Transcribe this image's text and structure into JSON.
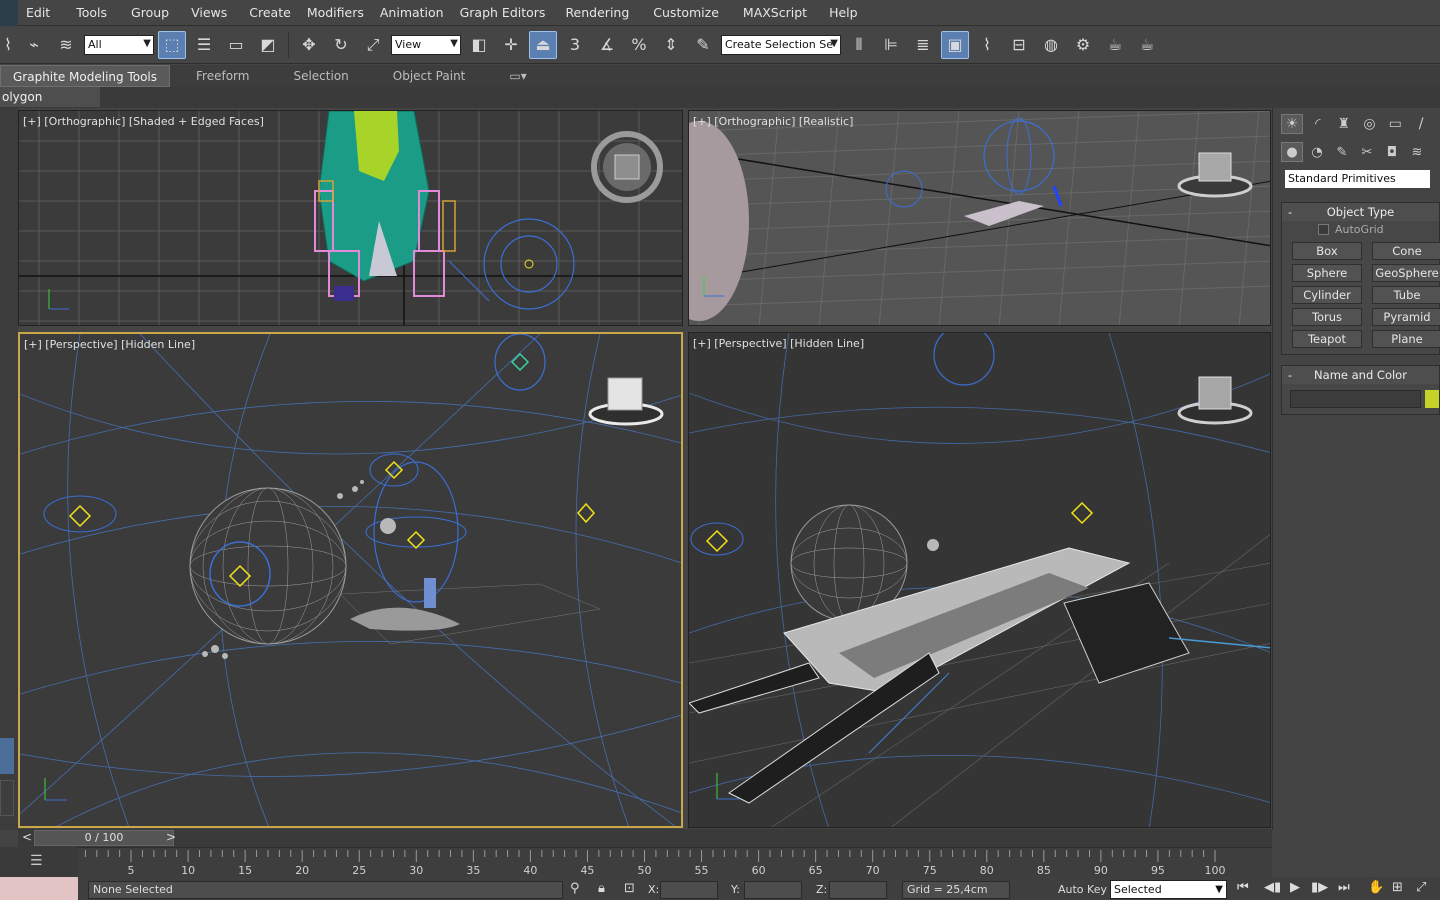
{
  "menubar": {
    "items": [
      "Edit",
      "Tools",
      "Group",
      "Views",
      "Create",
      "Modifiers",
      "Animation",
      "Graph Editors",
      "Rendering",
      "Customize",
      "MAXScript",
      "Help"
    ]
  },
  "toolbar": {
    "filter_value": "All",
    "refcoord_value": "View",
    "named_selection_value": "Create Selection Se",
    "snap_label": "3",
    "angle_label": "%",
    "icons": [
      "link-icon",
      "unlink-icon",
      "bind-icon",
      "select-icon",
      "select-by-name-icon",
      "rect-region-icon",
      "window-crossing-icon",
      "move-icon",
      "rotate-icon",
      "scale-icon",
      "pivot-icon",
      "manipulate-icon",
      "snap-icon",
      "angle-snap-icon",
      "percent-snap-icon",
      "spinner-snap-icon",
      "edit-named-sel-icon",
      "mirror-icon",
      "align-icon",
      "layer-icon",
      "scene-explorer-icon",
      "curve-editor-icon",
      "schematic-icon",
      "material-editor-icon",
      "render-setup-icon",
      "rendered-frame-icon",
      "render-icon"
    ]
  },
  "ribbon": {
    "tabs": [
      "Graphite Modeling Tools",
      "Freeform",
      "Selection",
      "Object Paint"
    ],
    "sub_label": "olygon Modeling"
  },
  "viewports": {
    "top_left_label": "[+] [Orthographic] [Shaded + Edged Faces]",
    "top_right_label": "[+] [Orthographic] [Realistic]",
    "bottom_left_label": "[+] [Perspective] [Hidden Line]",
    "bottom_right_label": "[+] [Perspective] [Hidden Line]"
  },
  "command_panel": {
    "category_value": "Standard Primitives",
    "object_type_title": "Object Type",
    "autogrid_label": "AutoGrid",
    "primitives": [
      "Box",
      "Cone",
      "Sphere",
      "GeoSphere",
      "Cylinder",
      "Tube",
      "Torus",
      "Pyramid",
      "Teapot",
      "Plane"
    ],
    "name_color_title": "Name and Color",
    "swatch_color": "#c4d22a"
  },
  "timeline": {
    "frame_display": "0 / 100",
    "ticks": [
      "5",
      "10",
      "15",
      "20",
      "25",
      "30",
      "35",
      "40",
      "45",
      "50",
      "55",
      "60",
      "65",
      "70",
      "75",
      "80",
      "85",
      "90",
      "95",
      "100"
    ]
  },
  "status": {
    "selection_text": "None Selected",
    "x_label": "X:",
    "y_label": "Y:",
    "z_label": "Z:",
    "grid_text": "Grid = 25,4cm",
    "autokey_label": "Auto Key",
    "keymode_value": "Selected"
  },
  "colors": {
    "accent": "#5b7fb0",
    "active_viewport_border": "#c8a84a",
    "wire_blue": "#4a7fd6",
    "helper_yellow": "#f2e21a"
  }
}
